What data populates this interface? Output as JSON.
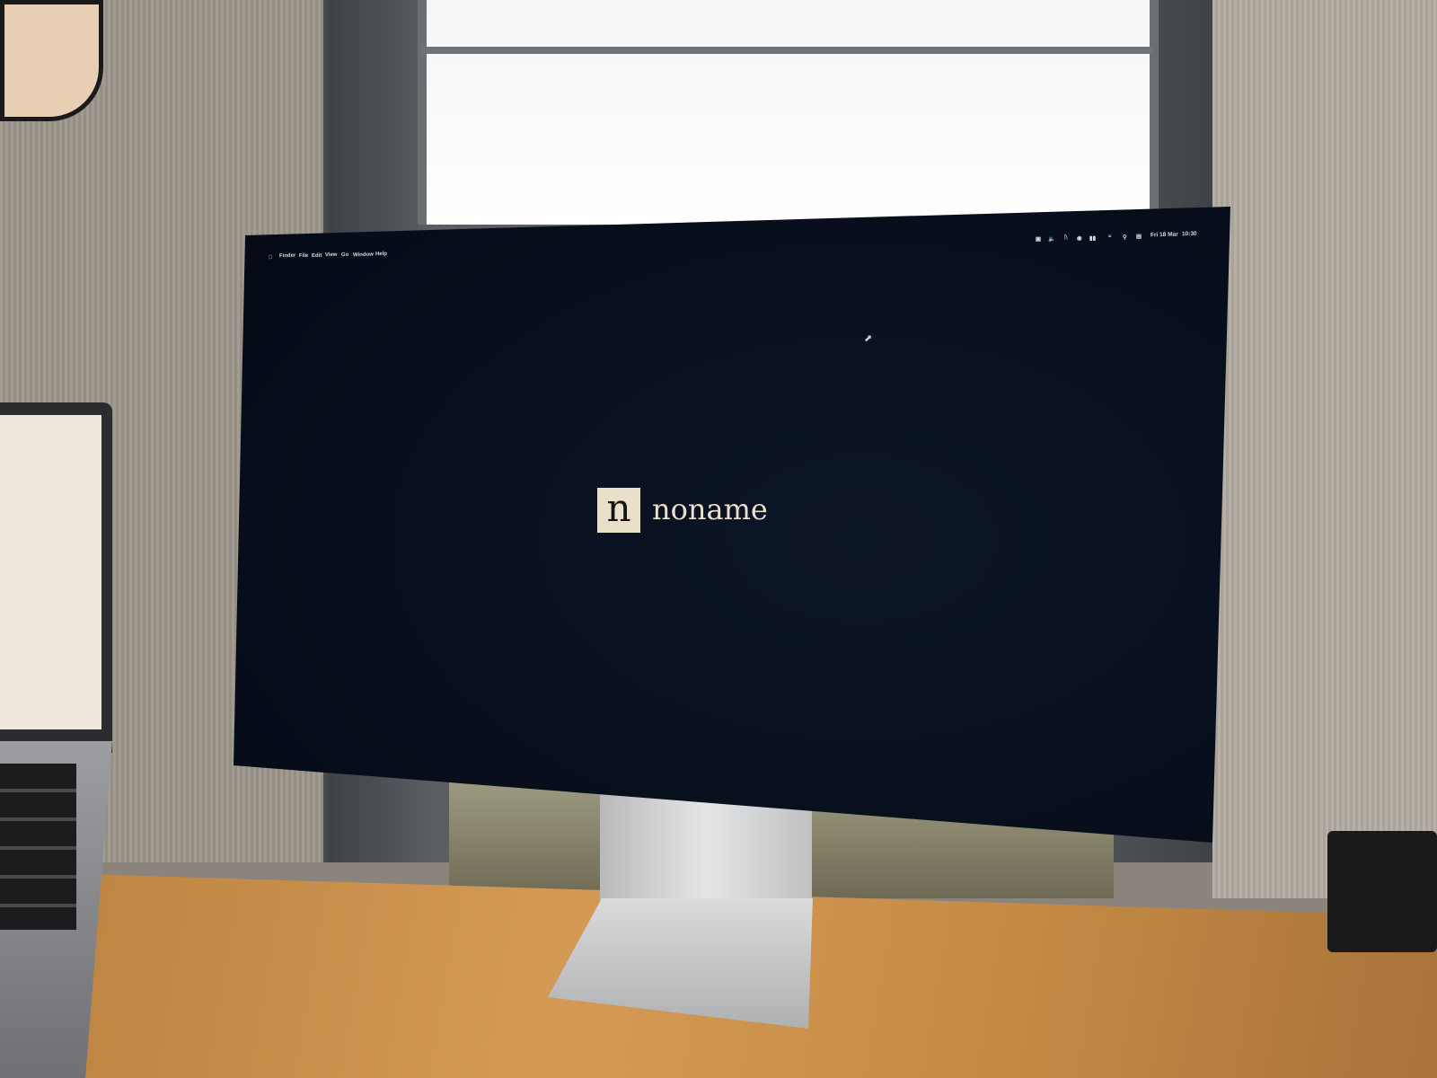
{
  "menubar": {
    "apple_icon": "apple-icon",
    "items": [
      "Finder",
      "File",
      "Edit",
      "View",
      "Go",
      "Window",
      "Help"
    ],
    "status_icons": [
      "screen-lock-icon",
      "volume-icon",
      "bluetooth-icon",
      "focus-icon",
      "battery-icon",
      "wifi-icon",
      "search-icon",
      "control-center-icon"
    ],
    "date": "Fri 18 Mar",
    "time": "10:30"
  },
  "desktop": {
    "logo_letter": "n",
    "logo_text": "noname"
  }
}
